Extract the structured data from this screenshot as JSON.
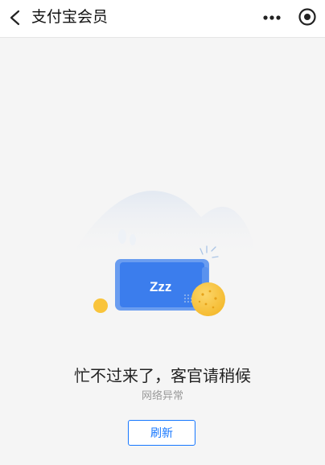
{
  "navbar": {
    "title": "支付宝会员",
    "back_icon": "chevron-left-icon",
    "more_icon": "more-dots-icon",
    "close_icon": "target-close-icon"
  },
  "error": {
    "title": "忙不过来了，客官请稍候",
    "subtitle": "网络异常",
    "illustration_text": "Zzz",
    "refresh_label": "刷新"
  },
  "colors": {
    "accent": "#1677ff",
    "phone": "#3b82f6",
    "coin": "#f9c43b",
    "background": "#f5f5f5"
  }
}
